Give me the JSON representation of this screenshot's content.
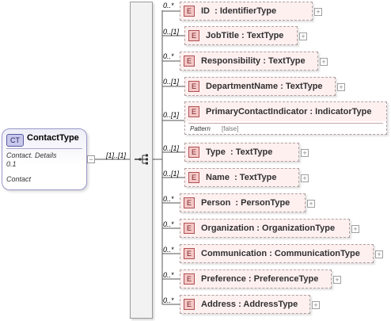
{
  "complex_type": {
    "badge": "CT",
    "name": "ContactType",
    "doc_line1": "Contact. Details",
    "doc_line2": "0.1",
    "doc_line3": "Contact",
    "sequence_multiplicity": "[1]..[1]"
  },
  "elements": [
    {
      "badge": "E",
      "name": "ID",
      "type_label": "  : IdentifierType",
      "multiplicity": "0..*"
    },
    {
      "badge": "E",
      "name": "JobTitle",
      "type_label": " : TextType",
      "multiplicity": "0..[1]"
    },
    {
      "badge": "E",
      "name": "Responsibility",
      "type_label": " : TextType",
      "multiplicity": "0..*"
    },
    {
      "badge": "E",
      "name": "DepartmentName",
      "type_label": " : TextType",
      "multiplicity": "0..[1]"
    },
    {
      "badge": "E",
      "name": "PrimaryContactIndicator",
      "type_label": " : IndicatorType",
      "multiplicity": "0..[1]",
      "facet_name": "Pattern",
      "facet_value": "[false]"
    },
    {
      "badge": "E",
      "name": "Type",
      "type_label": "  : TextType",
      "multiplicity": "0..[1]"
    },
    {
      "badge": "E",
      "name": "Name",
      "type_label": "  : TextType",
      "multiplicity": "0..[1]"
    },
    {
      "badge": "E",
      "name": "Person",
      "type_label": "  : PersonType",
      "multiplicity": "0..*"
    },
    {
      "badge": "E",
      "name": "Organization",
      "type_label": " : OrganizationType",
      "multiplicity": "0..*"
    },
    {
      "badge": "E",
      "name": "Communication",
      "type_label": " : CommunicationType",
      "multiplicity": "0..*"
    },
    {
      "badge": "E",
      "name": "Preference",
      "type_label": " : PreferenceType",
      "multiplicity": "0..*"
    },
    {
      "badge": "E",
      "name": "Address",
      "type_label": " : AddressType",
      "multiplicity": "0..*"
    }
  ],
  "expand_symbol": "+",
  "collapse_symbol": "−",
  "colors": {
    "element_fill": "#fff0f0",
    "element_badge": "#f4c8c8",
    "complex_type_badge": "#c8c8ec",
    "connector": "#555555"
  }
}
